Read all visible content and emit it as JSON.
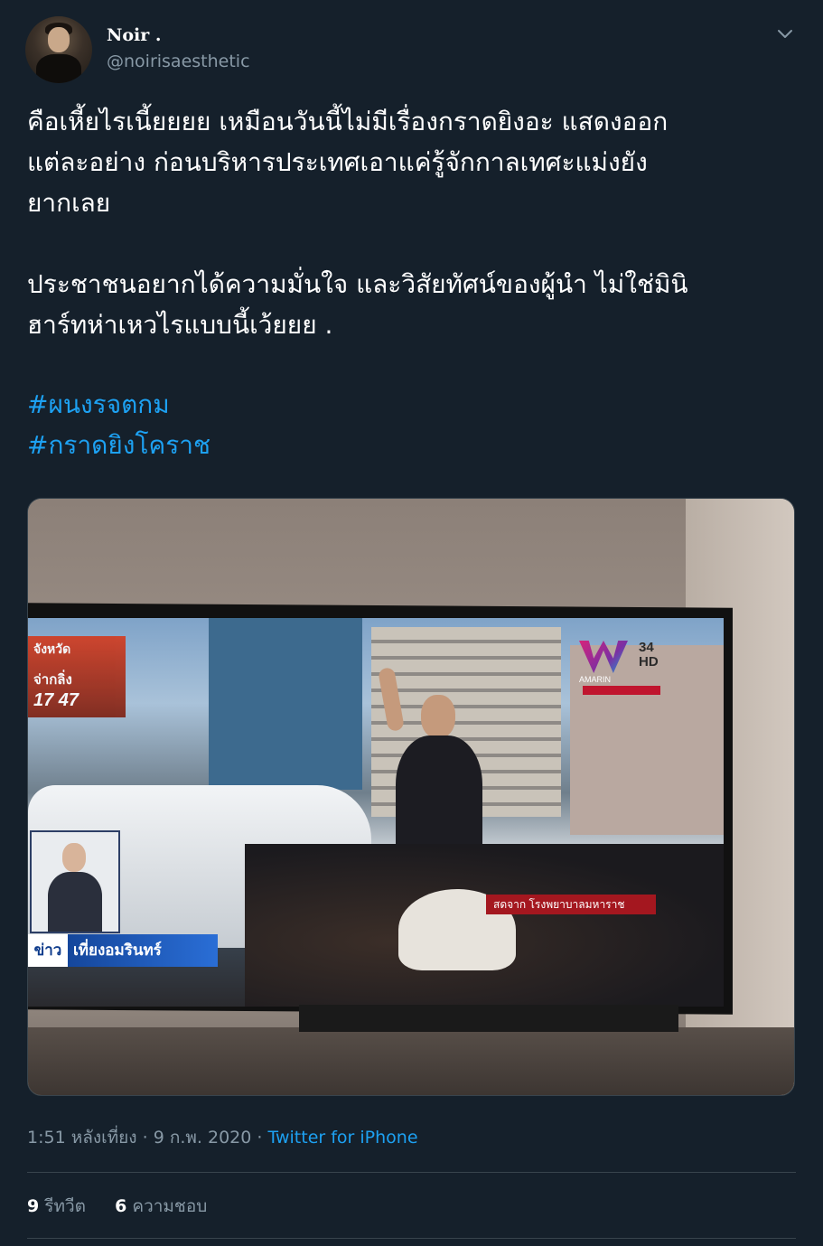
{
  "author": {
    "display_name": "Noir .",
    "handle": "@noirisaesthetic"
  },
  "tweet": {
    "paragraphs": [
      "คือเหี้ยไรเนี้ยยยย เหมือนวันนี้ไม่มีเรื่องกราดยิงอะ แสดงออก\nแต่ละอย่าง ก่อนบริหารประเทศเอาแค่รู้จักกาลเทศะแม่งยัง\nยากเลย",
      "ประชาชนอยากได้ความมั่นใจ และวิสัยทัศน์ของผู้นำ ไม่ใช่มินิ\nฮาร์ทห่าเหวไรแบบนี้เว้ยยย ."
    ],
    "hashtags": [
      "#ผนงรจตกม",
      "#กราดยิงโคราช"
    ]
  },
  "media": {
    "tv_channel_number": "34",
    "tv_channel_hd": "HD",
    "tv_brand": "AMARIN",
    "tv_score_line1": "จังหวัด",
    "tv_score_line2": "จ่ากลิ่ง",
    "tv_score_nums": "17 47",
    "tv_news_tag": "ข่าว",
    "tv_news_title": "เที่ยงอมรินทร์",
    "tv_location": "สดจาก โรงพยาบาลมหาราช"
  },
  "meta": {
    "time": "1:51 หลังเที่ยง",
    "separator1": "·",
    "date": "9 ก.พ. 2020",
    "separator2": "·",
    "source": "Twitter for iPhone"
  },
  "stats": {
    "retweets_count": "9",
    "retweets_label": "รีทวีต",
    "likes_count": "6",
    "likes_label": "ความชอบ"
  },
  "colors": {
    "background": "#15202b",
    "accent": "#1da1f2",
    "secondary_text": "#8899a6",
    "divider": "#38444d"
  },
  "icons": {
    "menu": "chevron-down-icon"
  }
}
